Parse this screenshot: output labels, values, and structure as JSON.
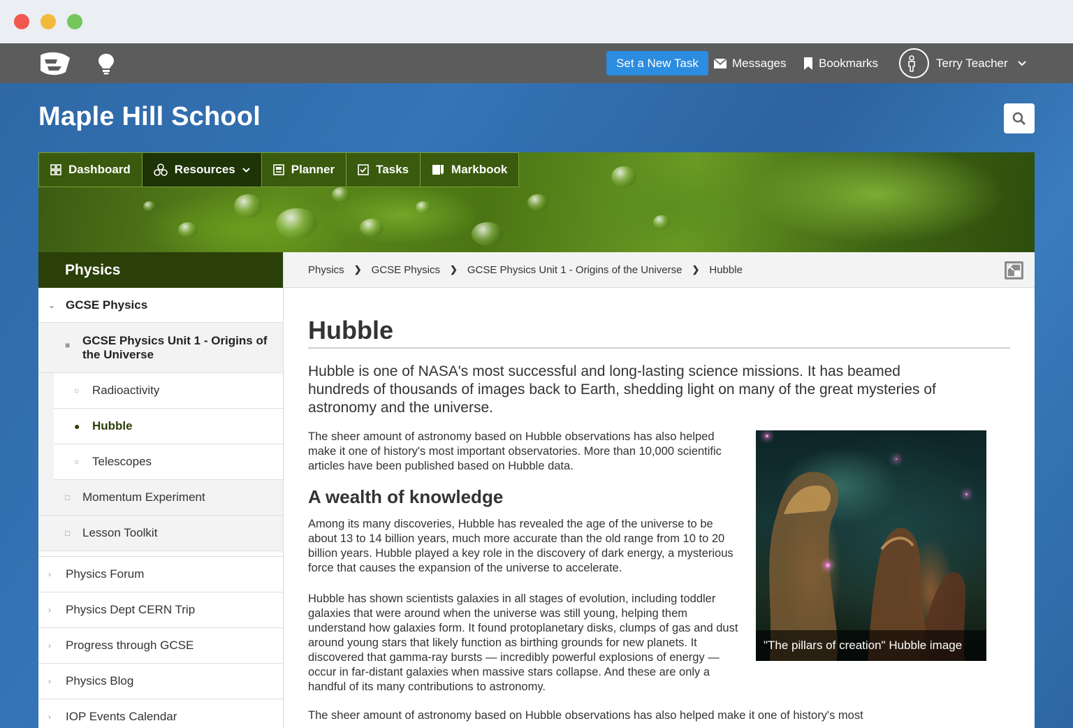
{
  "topbar": {
    "set_task_label": "Set a New Task",
    "messages_label": "Messages",
    "bookmarks_label": "Bookmarks",
    "user_name": "Terry Teacher"
  },
  "school": {
    "name": "Maple Hill School"
  },
  "mainnav": {
    "items": [
      {
        "label": "Dashboard",
        "icon": "dashboard-grid-icon"
      },
      {
        "label": "Resources",
        "icon": "resources-icon"
      },
      {
        "label": "Planner",
        "icon": "planner-icon"
      },
      {
        "label": "Tasks",
        "icon": "tasks-checkbox-icon"
      },
      {
        "label": "Markbook",
        "icon": "markbook-icon"
      }
    ]
  },
  "sidebar": {
    "title": "Physics",
    "section": "GCSE Physics",
    "unit": "GCSE Physics Unit 1 - Origins of the Universe",
    "unit_children": [
      "Radioactivity",
      "Hubble",
      "Telescopes"
    ],
    "section_children": [
      "Momentum Experiment",
      "Lesson Toolkit"
    ],
    "top_items": [
      "Physics Forum",
      "Physics Dept CERN Trip",
      "Progress through GCSE",
      "Physics Blog",
      "IOP Events Calendar"
    ]
  },
  "breadcrumb": [
    "Physics",
    "GCSE Physics",
    "GCSE Physics Unit 1 - Origins of the Universe",
    "Hubble"
  ],
  "article": {
    "title": "Hubble",
    "lead": "Hubble is one of NASA's most successful and long-lasting science missions. It has beamed hundreds of thousands of images back to Earth, shedding light on many of the great mysteries of astronomy and the universe.",
    "p1": "The sheer amount of astronomy based on Hubble observations has also helped make it one of history's most important observatories. More than 10,000 scientific articles have been published based on Hubble data.",
    "subheading": "A wealth of knowledge",
    "p2": "Among its many discoveries, Hubble has revealed the age of the universe to be about 13 to 14 billion years, much more accurate than the old range from 10 to 20 billion years. Hubble played a key role in the discovery of dark energy, a mysterious force that causes the expansion of the universe to accelerate.",
    "p3": "Hubble has shown scientists galaxies in all stages of evolution, including toddler galaxies that were around when the universe was still young, helping them understand how galaxies form. It found protoplanetary disks, clumps of gas and dust around young stars that likely function as birthing grounds for new planets. It discovered that gamma-ray bursts — incredibly powerful explosions of energy — occur in far-distant galaxies when massive stars collapse. And these are only a handful of its many contributions to astronomy.",
    "p4": "The sheer amount of astronomy based on Hubble observations has also helped make it one of history's most",
    "image_caption": "\"The pillars of creation\" Hubble image"
  },
  "colors": {
    "accent_blue": "#2b8ce0",
    "nav_green": "#3a5a0e",
    "sidebar_head": "#2b3f09",
    "topbar": "#5c5c5c"
  }
}
